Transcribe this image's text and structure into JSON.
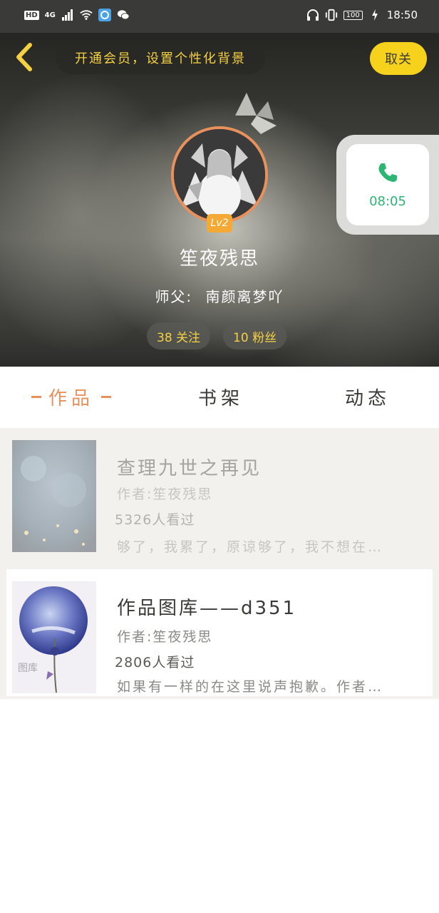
{
  "status_bar": {
    "hd_label": "HD",
    "network_label": "4G",
    "battery": "100",
    "time": "18:50"
  },
  "header": {
    "vip_banner": "开通会员，设置个性化背景",
    "follow_label": "取关"
  },
  "profile": {
    "level": "Lv2",
    "username": "笙夜残思",
    "master_label": "师父:",
    "master_name": "南颜离梦吖",
    "following": "38 关注",
    "followers": "10 粉丝"
  },
  "call_widget": {
    "duration": "08:05"
  },
  "tabs": [
    {
      "label": "作品"
    },
    {
      "label": "书架"
    },
    {
      "label": "动态"
    }
  ],
  "works": [
    {
      "title": "查理九世之再见",
      "author": "作者:笙夜残思",
      "views": "5326人看过",
      "desc": "够了，我累了，原谅够了，我不想在…"
    },
    {
      "title": "作品图库——d351",
      "author": "作者:笙夜残思",
      "views": "2806人看过",
      "desc": "如果有一样的在这里说声抱歉。作者…",
      "thumb_tag": "图库"
    }
  ],
  "colors": {
    "accent_orange": "#e8915c",
    "accent_yellow": "#f7d21d",
    "call_green": "#2bb673"
  }
}
